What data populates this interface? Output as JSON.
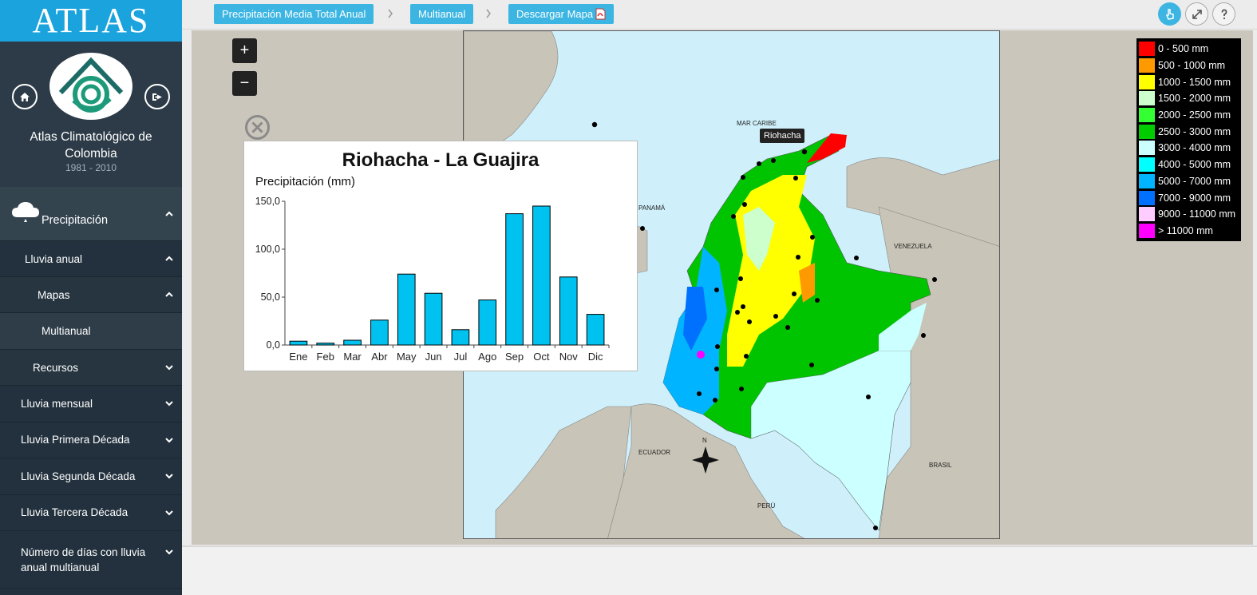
{
  "app": {
    "logo_text": "ATLAS",
    "title": "Atlas Climatológico de Colombia",
    "years": "1981 - 2010"
  },
  "sidebar": {
    "section": "Precipitación",
    "sub": "Lluvia anual",
    "maps": "Mapas",
    "multianual": "Multianual",
    "recursos": "Recursos",
    "items": [
      "Lluvia mensual",
      "Lluvia Primera Década",
      "Lluvia Segunda Década",
      "Lluvia Tercera Década"
    ],
    "last_item": "Número de días con lluvia anual multianual"
  },
  "breadcrumb": {
    "first": "Precipitación Media Total Anual",
    "second": "Multianual",
    "download": "Descargar Mapa"
  },
  "map": {
    "tooltip": "Riohacha",
    "labels": {
      "caribe": "MAR CARIBE",
      "panama": "PANAMÁ",
      "venezuela": "VENEZUELA",
      "ecuador": "ECUADOR",
      "peru": "PERÚ",
      "brasil": "BRASIL",
      "north": "N"
    },
    "zoom_in": "+",
    "zoom_out": "−"
  },
  "legend": [
    {
      "label": "0 - 500 mm",
      "color": "#ff0000"
    },
    {
      "label": "500 - 1000 mm",
      "color": "#ff9900"
    },
    {
      "label": "1000 - 1500 mm",
      "color": "#ffff00"
    },
    {
      "label": "1500 - 2000 mm",
      "color": "#ccffcc"
    },
    {
      "label": "2000 - 2500 mm",
      "color": "#33ff33"
    },
    {
      "label": "2500 - 3000 mm",
      "color": "#00cc00"
    },
    {
      "label": "3000 - 4000 mm",
      "color": "#ccffff"
    },
    {
      "label": "4000 - 5000 mm",
      "color": "#00ffff"
    },
    {
      "label": "5000 - 7000 mm",
      "color": "#00b4ff"
    },
    {
      "label": "7000 - 9000 mm",
      "color": "#0070ff"
    },
    {
      "label": "9000 - 11000 mm",
      "color": "#ffccff"
    },
    {
      "label": "> 11000 mm",
      "color": "#ff00ff"
    }
  ],
  "chart_data": {
    "type": "bar",
    "title": "Riohacha - La Guajira",
    "ylabel": "Precipitación (mm)",
    "xlabel": "",
    "categories": [
      "Ene",
      "Feb",
      "Mar",
      "Abr",
      "May",
      "Jun",
      "Jul",
      "Ago",
      "Sep",
      "Oct",
      "Nov",
      "Dic"
    ],
    "values": [
      4,
      2,
      5,
      26,
      74,
      54,
      16,
      47,
      137,
      145,
      71,
      32
    ],
    "ylim": [
      0,
      150
    ],
    "yticks": [
      "0,0",
      "50,0",
      "100,0",
      "150,0"
    ],
    "bar_color": "#00c2f0",
    "grid": false
  }
}
